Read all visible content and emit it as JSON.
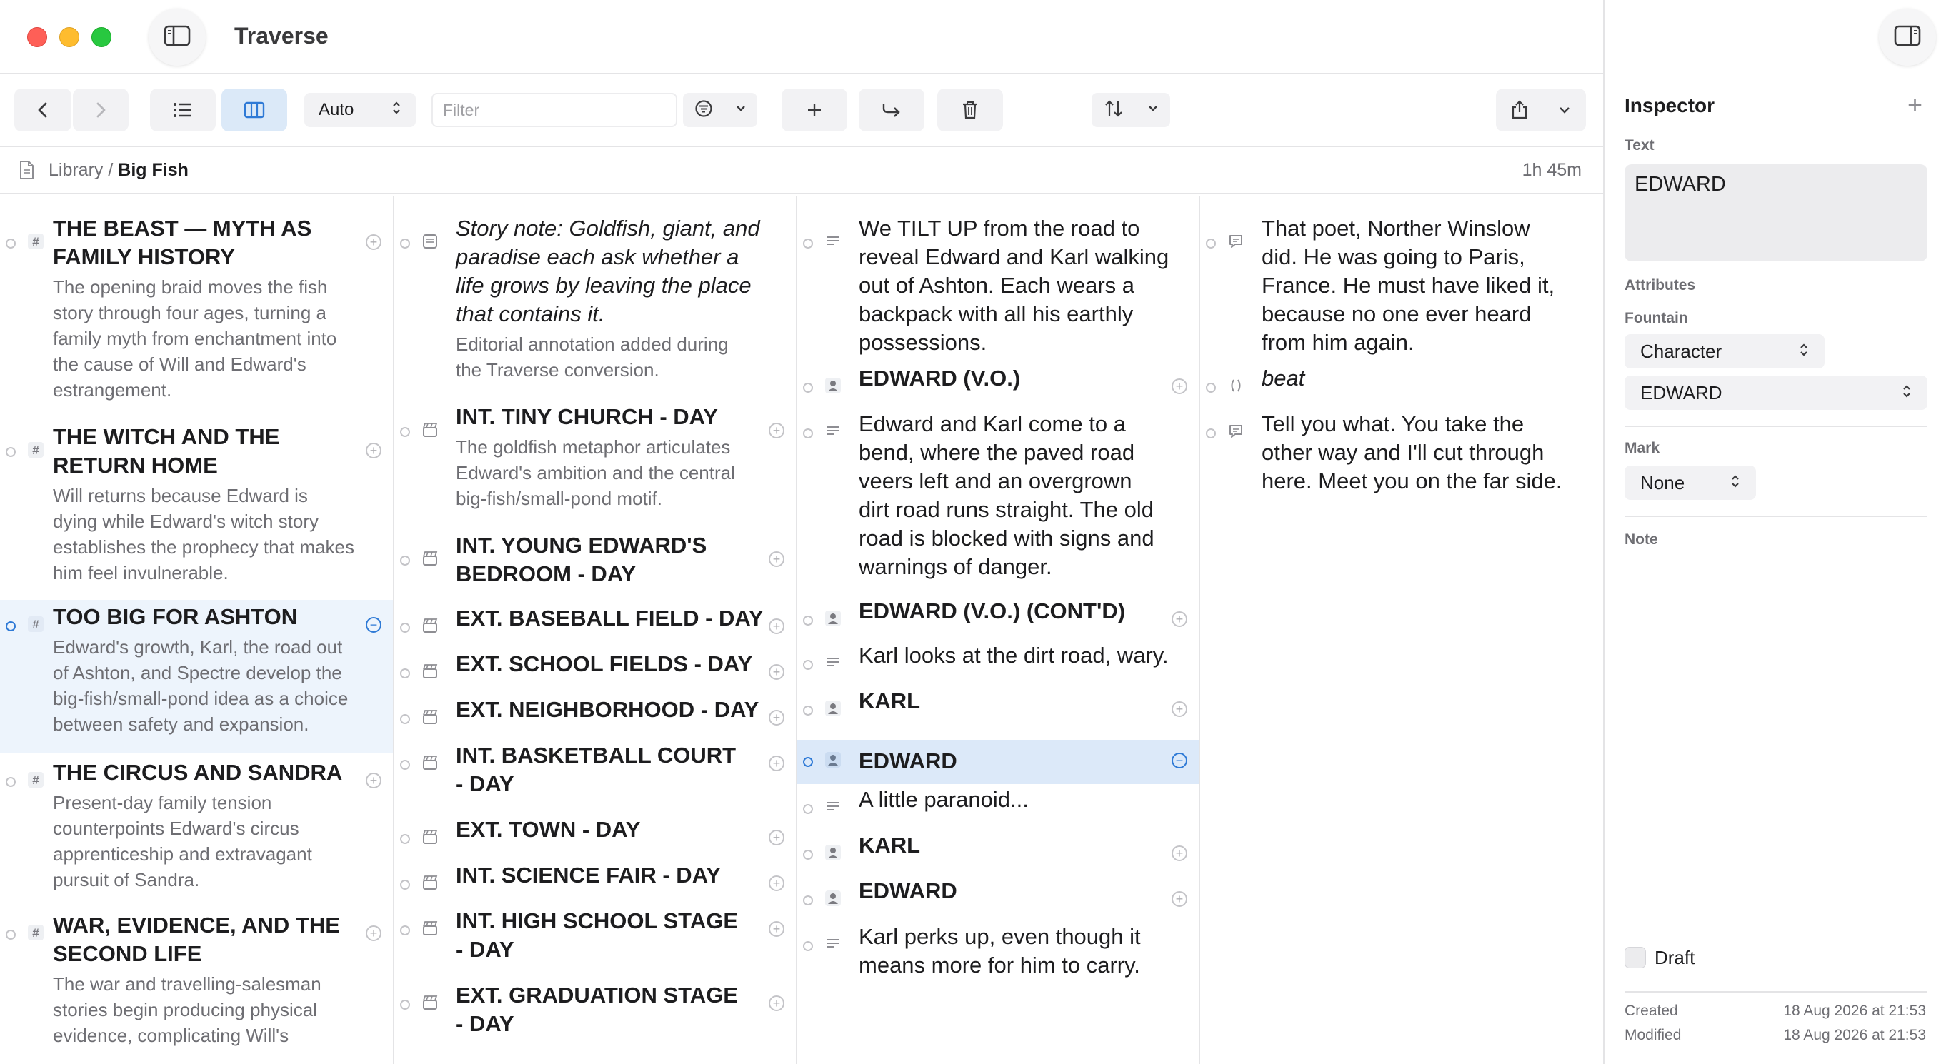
{
  "window": {
    "title": "Traverse"
  },
  "toolbar": {
    "auto_select": "Auto",
    "filter_placeholder": "Filter"
  },
  "pathbar": {
    "library": "Library",
    "separator": " / ",
    "document": "Big Fish",
    "duration": "1h 45m"
  },
  "columns": {
    "col1": [
      {
        "title": "THE BEAST — MYTH AS FAMILY HISTORY",
        "title_lines": [
          "THE BEAST — MYTH AS",
          "FAMILY HISTORY"
        ],
        "summary_lines": [
          "The opening braid moves the fish",
          "story through four ages, turning a",
          "family myth from enchantment into",
          "the cause of Will and Edward's",
          "estrangement."
        ]
      },
      {
        "title_lines": [
          "THE WITCH AND THE",
          "RETURN HOME"
        ],
        "summary_lines": [
          "Will returns because Edward is",
          "dying while Edward's witch story",
          "establishes the prophecy that makes",
          "him feel invulnerable."
        ]
      },
      {
        "title_lines": [
          "TOO BIG FOR ASHTON"
        ],
        "summary_lines": [
          "Edward's growth, Karl, the road out",
          "of Ashton, and Spectre develop the",
          "big-fish/small-pond idea as a choice",
          "between safety and expansion."
        ]
      },
      {
        "title_lines": [
          "THE CIRCUS AND SANDRA"
        ],
        "summary_lines": [
          "Present-day family tension",
          "counterpoints Edward's circus",
          "apprenticeship and extravagant",
          "pursuit of Sandra."
        ]
      },
      {
        "title_lines": [
          "WAR, EVIDENCE, AND THE",
          "SECOND LIFE"
        ],
        "summary_lines": [
          "The war and travelling-salesman",
          "stories begin producing physical",
          "evidence, complicating Will's"
        ]
      }
    ],
    "col2_note": {
      "lines": [
        "Story note: Goldfish, giant, and",
        "paradise each ask whether a",
        "life grows by leaving the place",
        "that contains it."
      ],
      "sub_lines": [
        "Editorial annotation added during",
        "the Traverse conversion."
      ]
    },
    "col2": [
      {
        "lines": [
          "INT.  TINY CHURCH - DAY"
        ],
        "sub_lines": [
          "The goldfish metaphor articulates",
          "Edward's ambition and the central",
          "big-fish/small-pond motif."
        ]
      },
      {
        "lines": [
          "INT.  YOUNG EDWARD'S",
          "BEDROOM - DAY"
        ]
      },
      {
        "lines": [
          "EXT.  BASEBALL FIELD - DAY"
        ]
      },
      {
        "lines": [
          "EXT.  SCHOOL FIELDS - DAY"
        ]
      },
      {
        "lines": [
          "EXT.  NEIGHBORHOOD - DAY"
        ]
      },
      {
        "lines": [
          "INT.  BASKETBALL COURT",
          "- DAY"
        ]
      },
      {
        "lines": [
          "EXT.  TOWN - DAY"
        ]
      },
      {
        "lines": [
          "INT.  SCIENCE FAIR - DAY"
        ]
      },
      {
        "lines": [
          "INT.  HIGH SCHOOL STAGE",
          "- DAY"
        ]
      },
      {
        "lines": [
          "EXT.  GRADUATION STAGE",
          "- DAY"
        ]
      }
    ],
    "col3": [
      {
        "kind": "action",
        "lines": [
          "We TILT UP from the road to",
          "reveal Edward and Karl walking",
          "out of Ashton.  Each wears a",
          "backpack with all his earthly",
          "possessions."
        ]
      },
      {
        "kind": "character",
        "lines": [
          "EDWARD (V.O.)"
        ]
      },
      {
        "kind": "action",
        "lines": [
          "Edward and Karl come to a",
          "bend, where the paved road",
          "veers left and an overgrown",
          "dirt road runs straight.  The old",
          "road is blocked with signs and",
          "warnings of danger."
        ]
      },
      {
        "kind": "character",
        "lines": [
          "EDWARD (V.O.) (CONT'D)"
        ]
      },
      {
        "kind": "action",
        "lines": [
          "Karl looks at the dirt road, wary."
        ]
      },
      {
        "kind": "character",
        "lines": [
          "KARL"
        ]
      },
      {
        "kind": "character",
        "lines": [
          "EDWARD"
        ]
      },
      {
        "kind": "action",
        "lines": [
          "A little paranoid..."
        ]
      },
      {
        "kind": "character",
        "lines": [
          "KARL"
        ]
      },
      {
        "kind": "character",
        "lines": [
          "EDWARD"
        ]
      },
      {
        "kind": "action",
        "lines": [
          "Karl perks up, even though it",
          "means more for him to carry."
        ]
      }
    ],
    "col4": [
      {
        "kind": "dialogue",
        "lines": [
          "That poet, Norther Winslow",
          "did.  He was going to Paris,",
          "France.  He must have liked it,",
          "because no one ever heard",
          "from him again."
        ]
      },
      {
        "kind": "parenthetical",
        "lines": [
          "beat"
        ]
      },
      {
        "kind": "dialogue",
        "lines": [
          "Tell you what.  You take the",
          "other way and I'll cut through",
          "here.  Meet you on the far side."
        ]
      }
    ]
  },
  "inspector": {
    "title": "Inspector",
    "text_label": "Text",
    "text_value": "EDWARD",
    "attributes_label": "Attributes",
    "fountain_label": "Fountain",
    "type_select": "Character",
    "name_select": "EDWARD",
    "mark_label": "Mark",
    "mark_select": "None",
    "note_label": "Note",
    "draft_label": "Draft",
    "created_label": "Created",
    "created_value": "18 Aug 2026 at 21:53",
    "modified_label": "Modified",
    "modified_value": "18 Aug 2026 at 21:53"
  },
  "colors": {
    "selection": "#dce9f9",
    "accent": "#2f7ad6",
    "highlight": "#edf4fc"
  },
  "icons": [
    "sidebar-left-icon",
    "chevron-left-icon",
    "chevron-right-icon",
    "list-icon",
    "columns-icon",
    "filter-icon",
    "plus-icon",
    "indent-arrow-icon",
    "trash-icon",
    "sort-icon",
    "share-icon",
    "chevron-down-icon",
    "document-icon",
    "heading-hash-icon",
    "note-icon",
    "scene-clapper-icon",
    "action-lines-icon",
    "character-person-icon",
    "dialogue-bubble-icon",
    "parenthetical-icon",
    "sidebar-right-icon"
  ]
}
